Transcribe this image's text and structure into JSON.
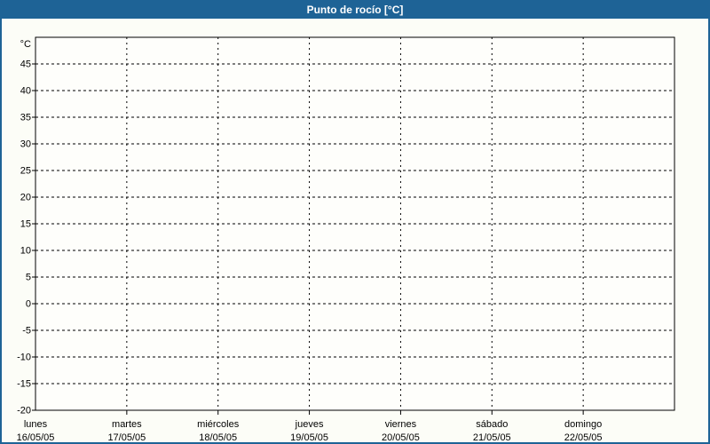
{
  "window": {
    "title": "Punto de rocío [°C]"
  },
  "colors": {
    "accent": "#1e6396",
    "title_text": "#ffffff",
    "page_bg": "#fcfdf7",
    "plot_bg": "#fefefb",
    "grid": "#000000",
    "text": "#000000"
  },
  "chart_data": {
    "type": "line",
    "title": "Punto de rocío [°C]",
    "ylabel": "°C",
    "ylim": [
      -20,
      50
    ],
    "ytick_step": 5,
    "yticks": [
      45,
      40,
      35,
      30,
      25,
      20,
      15,
      10,
      5,
      0,
      -5,
      -10,
      -15,
      -20
    ],
    "categories": [
      "lunes",
      "martes",
      "miércoles",
      "jueves",
      "viernes",
      "sábado",
      "domingo"
    ],
    "dates": [
      "16/05/05",
      "17/05/05",
      "18/05/05",
      "19/05/05",
      "20/05/05",
      "21/05/05",
      "22/05/05"
    ],
    "series": [],
    "grid": "dashed",
    "legend_position": "none"
  }
}
